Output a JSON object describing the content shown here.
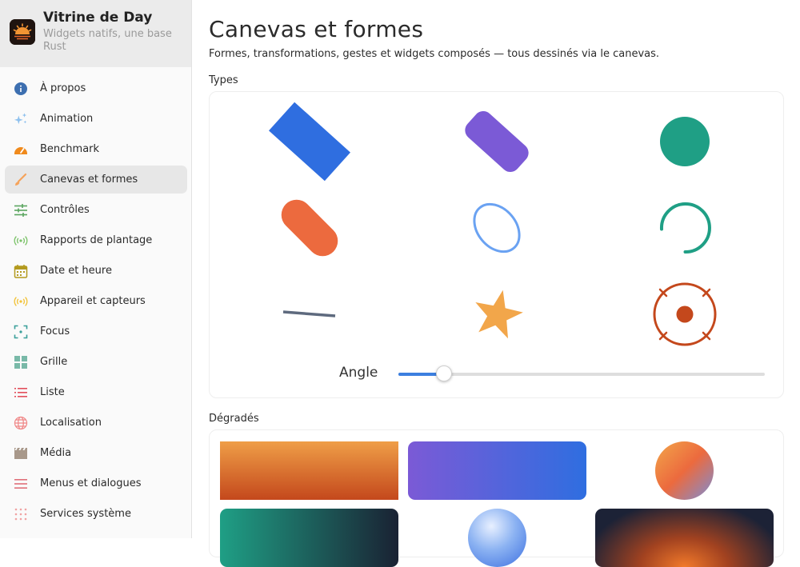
{
  "app": {
    "title": "Vitrine de Day",
    "subtitle": "Widgets natifs, une base Rust",
    "logo_icon": "sunset-icon"
  },
  "sidebar": {
    "items": [
      {
        "label": "À propos",
        "icon": "info-icon",
        "color": "#3d6fb0"
      },
      {
        "label": "Animation",
        "icon": "sparkles-icon",
        "color": "#8fc1ee"
      },
      {
        "label": "Benchmark",
        "icon": "gauge-icon",
        "color": "#f08a1c"
      },
      {
        "label": "Canevas et formes",
        "icon": "brush-icon",
        "color": "#f5a35b",
        "active": true
      },
      {
        "label": "Contrôles",
        "icon": "sliders-icon",
        "color": "#5aa55f"
      },
      {
        "label": "Rapports de plantage",
        "icon": "broadcast-icon",
        "color": "#7cc36a"
      },
      {
        "label": "Date et heure",
        "icon": "calendar-icon",
        "color": "#b39a1e"
      },
      {
        "label": "Appareil et capteurs",
        "icon": "sensor-icon",
        "color": "#f2c33a"
      },
      {
        "label": "Focus",
        "icon": "focus-icon",
        "color": "#3a9f9a"
      },
      {
        "label": "Grille",
        "icon": "grid-icon",
        "color": "#79b9a8"
      },
      {
        "label": "Liste",
        "icon": "list-icon",
        "color": "#e24f5c"
      },
      {
        "label": "Localisation",
        "icon": "globe-icon",
        "color": "#f08a8a"
      },
      {
        "label": "Média",
        "icon": "clapper-icon",
        "color": "#a8988a"
      },
      {
        "label": "Menus et dialogues",
        "icon": "menu-icon",
        "color": "#e0707a"
      },
      {
        "label": "Services système",
        "icon": "dots-grid-icon",
        "color": "#f0a3a3"
      }
    ]
  },
  "page": {
    "title": "Canevas et formes",
    "description": "Formes, transformations, gestes et widgets composés — tous dessinés via le canevas."
  },
  "types_section": {
    "label": "Types",
    "angle_label": "Angle",
    "angle_value": 0.125
  },
  "gradients_section": {
    "label": "Dégradés"
  },
  "colors": {
    "blue": "#2f6ee0",
    "purple": "#7b5ad6",
    "teal": "#1f9f85",
    "orange": "#ec6a3e",
    "light_blue": "#6aa2f2",
    "slate": "#5e6a7e",
    "amber": "#f2a64a",
    "rust": "#c4481c"
  }
}
